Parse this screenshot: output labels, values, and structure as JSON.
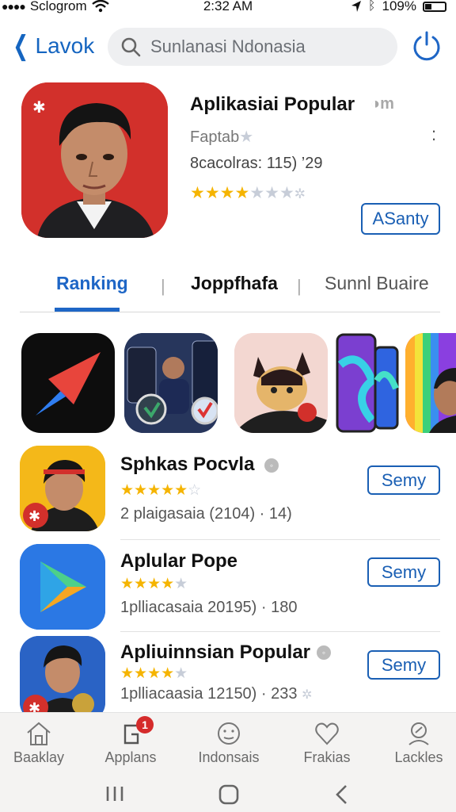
{
  "status_bar": {
    "carrier": "Sclogrom",
    "time": "2:32 AM",
    "battery": "109%"
  },
  "nav": {
    "back_label": "Lavok",
    "search_placeholder": "Sunlanasi Ndonasia"
  },
  "featured": {
    "title": "Aplikasiai Popular",
    "badge": "◑m",
    "subtitle": "Faptab",
    "meta": "8cacolras: 115)  ’29",
    "rating": 4,
    "button_label": "ASanty"
  },
  "tabs": [
    {
      "label": "Ranking",
      "active": true
    },
    {
      "label": "Joppfhafa",
      "active": false
    },
    {
      "label": "Sunnl Buaire",
      "active": false
    }
  ],
  "apps": [
    {
      "title": "Sphkas Pocvla",
      "rating": 5,
      "meta": "2 plaigasaia  (2104)  · 14)",
      "button": "Semy"
    },
    {
      "title": "Aplular Pope",
      "rating": 4,
      "meta": "1plliacasaia 20195)  · 180",
      "button": "Semy"
    },
    {
      "title": "Apliuinnsian Popular",
      "rating": 4,
      "meta": "1plliacaasia 12150)  · 233",
      "button": "Semy"
    }
  ],
  "tabbar": [
    {
      "label": "Baaklay",
      "icon": "home-icon"
    },
    {
      "label": "Applans",
      "icon": "apps-icon",
      "badge": "1"
    },
    {
      "label": "Indonsais",
      "icon": "smiley-icon"
    },
    {
      "label": "Frakias",
      "icon": "heart-icon"
    },
    {
      "label": "Lackles",
      "icon": "search-person-icon"
    }
  ],
  "colors": {
    "accent": "#1a5fb4",
    "star": "#f5b400",
    "feature_bg": "#d2302b"
  }
}
